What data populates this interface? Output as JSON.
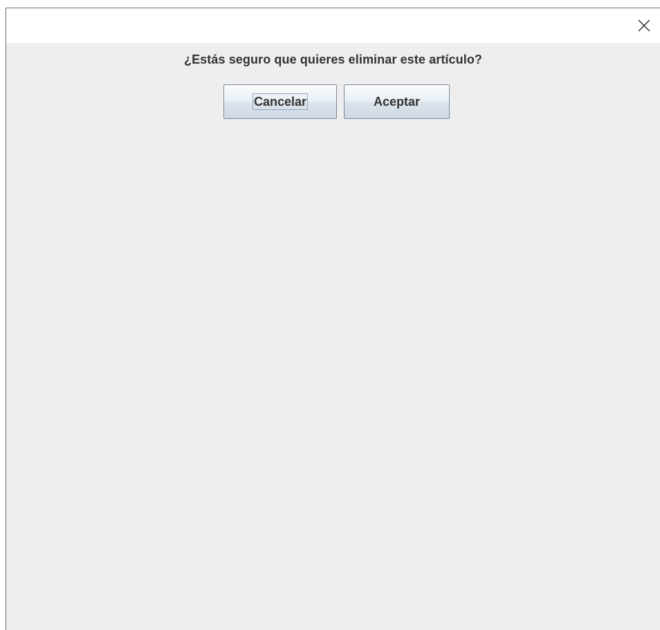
{
  "dialog": {
    "message": "¿Estás seguro que quieres eliminar este artículo?",
    "close_icon": "close-icon"
  },
  "buttons": {
    "cancel_label": "Cancelar",
    "accept_label": "Aceptar"
  },
  "colors": {
    "content_background": "#eeeeee",
    "titlebar_background": "#ffffff",
    "text": "#333333"
  }
}
